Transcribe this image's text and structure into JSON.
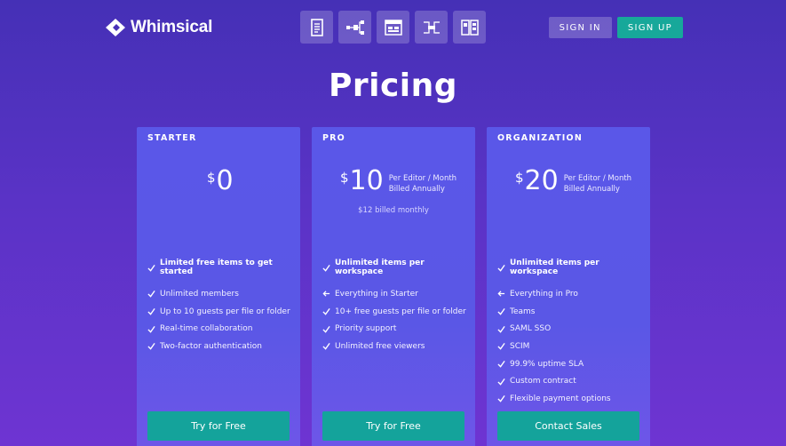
{
  "nav": {
    "brand": "Whimsical",
    "tools": [
      {
        "name": "docs-icon"
      },
      {
        "name": "flowchart-icon"
      },
      {
        "name": "wireframe-icon"
      },
      {
        "name": "mindmap-icon"
      },
      {
        "name": "board-icon"
      }
    ],
    "sign_in": "SIGN IN",
    "sign_up": "SIGN UP"
  },
  "page": {
    "title": "Pricing"
  },
  "colors": {
    "accent": "#17a89a",
    "card": "#5a57e8"
  },
  "plans": [
    {
      "name": "STARTER",
      "currency": "$",
      "price": "0",
      "per_line1": "",
      "per_line2": "",
      "monthly": "",
      "headline": "Limited free items to get started",
      "features": [
        {
          "icon": "check-icon",
          "text": "Unlimited members"
        },
        {
          "icon": "check-icon",
          "text": "Up to 10 guests per file or folder"
        },
        {
          "icon": "check-icon",
          "text": "Real-time collaboration"
        },
        {
          "icon": "check-icon",
          "text": "Two-factor authentication"
        }
      ],
      "cta": "Try for Free"
    },
    {
      "name": "PRO",
      "currency": "$",
      "price": "10",
      "per_line1": "Per Editor / Month",
      "per_line2": "Billed Annually",
      "monthly": "$12 billed monthly",
      "headline": "Unlimited items per workspace",
      "features": [
        {
          "icon": "arrow-left-icon",
          "text": "Everything in Starter"
        },
        {
          "icon": "check-icon",
          "text": "10+ free guests per file or folder"
        },
        {
          "icon": "check-icon",
          "text": "Priority support"
        },
        {
          "icon": "check-icon",
          "text": "Unlimited free viewers"
        }
      ],
      "cta": "Try for Free"
    },
    {
      "name": "ORGANIZATION",
      "currency": "$",
      "price": "20",
      "per_line1": "Per Editor / Month",
      "per_line2": "Billed Annually",
      "monthly": "",
      "headline": "Unlimited items per workspace",
      "features": [
        {
          "icon": "arrow-left-icon",
          "text": "Everything in Pro"
        },
        {
          "icon": "check-icon",
          "text": "Teams"
        },
        {
          "icon": "check-icon",
          "text": "SAML SSO"
        },
        {
          "icon": "check-icon",
          "text": "SCIM"
        },
        {
          "icon": "check-icon",
          "text": "99.9% uptime SLA"
        },
        {
          "icon": "check-icon",
          "text": "Custom contract"
        },
        {
          "icon": "check-icon",
          "text": "Flexible payment options"
        }
      ],
      "cta": "Contact Sales"
    }
  ]
}
